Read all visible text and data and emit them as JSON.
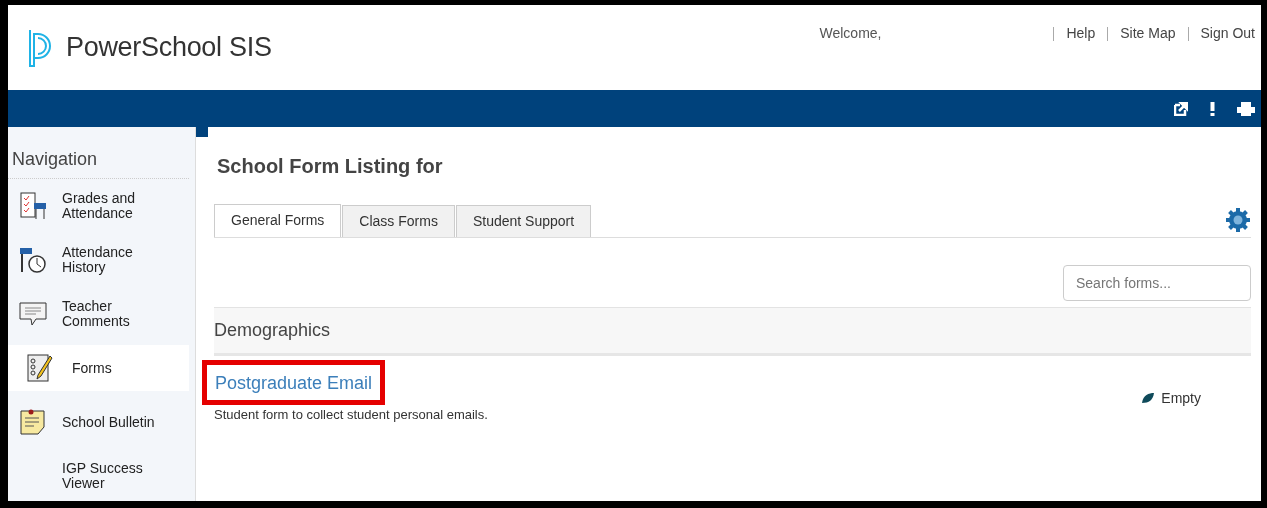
{
  "header": {
    "product": "PowerSchool SIS",
    "welcome": "Welcome,",
    "links": [
      "Help",
      "Site Map",
      "Sign Out"
    ]
  },
  "sidebar": {
    "title": "Navigation",
    "items": [
      {
        "label": "Grades and Attendance",
        "selected": false
      },
      {
        "label": "Attendance History",
        "selected": false
      },
      {
        "label": "Teacher Comments",
        "selected": false
      },
      {
        "label": "Forms",
        "selected": true
      },
      {
        "label": "School Bulletin",
        "selected": false
      },
      {
        "label": "IGP Success Viewer",
        "selected": false
      }
    ]
  },
  "page": {
    "title": "School Form Listing for",
    "tabs": [
      {
        "label": "General Forms",
        "selected": true
      },
      {
        "label": "Class Forms",
        "selected": false
      },
      {
        "label": "Student Support",
        "selected": false
      }
    ],
    "search": {
      "placeholder": "Search forms..."
    },
    "section": "Demographics",
    "forms": [
      {
        "name": "Postgraduate Email",
        "description": "Student form to collect student personal emails.",
        "status": "Empty",
        "highlighted": true
      }
    ]
  }
}
